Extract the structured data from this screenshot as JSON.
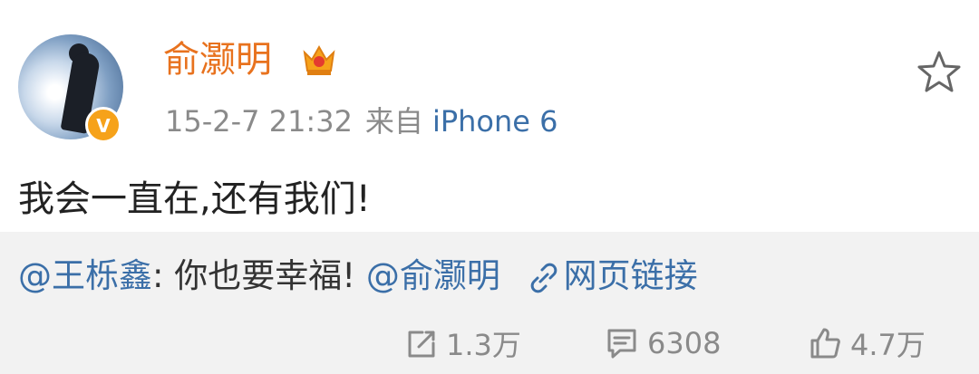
{
  "post": {
    "author": "俞灏明",
    "timestamp": "15-2-7 21:32",
    "via_label": "来自",
    "device": "iPhone 6",
    "content": "我会一直在,还有我们!"
  },
  "repost": {
    "mention": "@王栎鑫",
    "separator": ":",
    "text": " 你也要幸福!",
    "mention_2": "@俞灏明",
    "link_label": "网页链接"
  },
  "actions": {
    "share_count": "1.3万",
    "comment_count": "6308",
    "like_count": "4.7万"
  },
  "colors": {
    "author": "#e8721e",
    "link": "#3b6fa8",
    "meta": "#8a8a8a",
    "repost_bg": "#f2f2f2",
    "verified_badge": "#f6a21a"
  },
  "icons": [
    "crown-icon",
    "verified-badge-icon",
    "star-icon",
    "link-icon",
    "share-icon",
    "comment-icon",
    "like-icon"
  ]
}
